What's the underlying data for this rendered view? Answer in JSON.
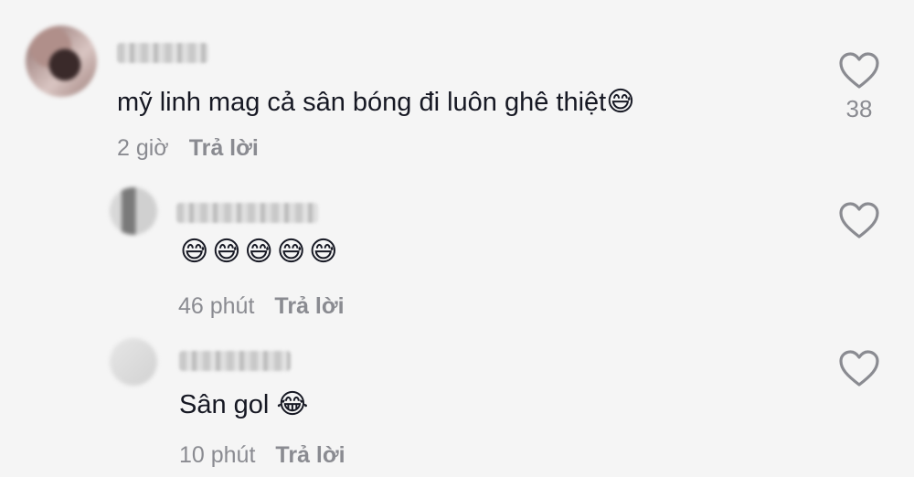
{
  "comments": [
    {
      "username": "",
      "text": "mỹ linh mag cả sân bóng đi luôn ghê thiệt",
      "emoji": "😅",
      "time": "2 giờ",
      "reply_label": "Trả lời",
      "likes": "38",
      "icon": "heart-outline-icon"
    }
  ],
  "replies": [
    {
      "username": "",
      "emojis": "😅😅😅😅😅",
      "time": "46 phút",
      "reply_label": "Trả lời",
      "icon": "heart-outline-icon"
    },
    {
      "username": "",
      "text": "Sân gol",
      "emoji": "😂",
      "time": "10 phút",
      "reply_label": "Trả lời",
      "icon": "heart-outline-icon"
    }
  ],
  "colors": {
    "background": "#f5f5f5",
    "text": "#161823",
    "muted": "#8a8b91"
  }
}
